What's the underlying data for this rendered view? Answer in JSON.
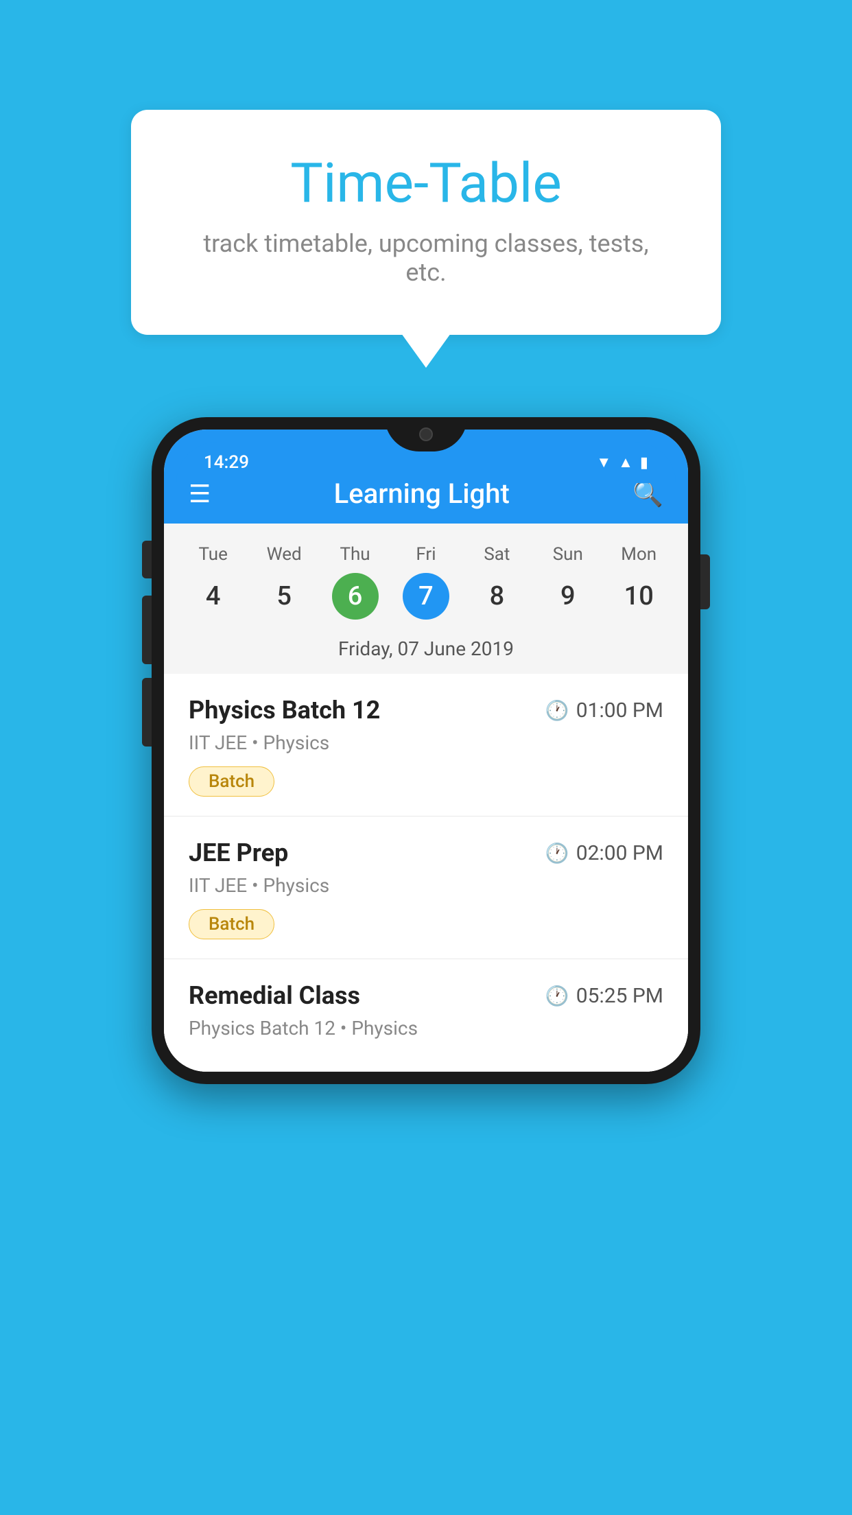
{
  "background_color": "#29B6E8",
  "tooltip": {
    "title": "Time-Table",
    "subtitle": "track timetable, upcoming classes, tests, etc."
  },
  "phone": {
    "status_bar": {
      "time": "14:29"
    },
    "app_bar": {
      "title": "Learning Light",
      "menu_icon": "☰",
      "search_icon": "🔍"
    },
    "calendar": {
      "days": [
        {
          "name": "Tue",
          "num": "4",
          "state": "normal"
        },
        {
          "name": "Wed",
          "num": "5",
          "state": "normal"
        },
        {
          "name": "Thu",
          "num": "6",
          "state": "today"
        },
        {
          "name": "Fri",
          "num": "7",
          "state": "selected"
        },
        {
          "name": "Sat",
          "num": "8",
          "state": "normal"
        },
        {
          "name": "Sun",
          "num": "9",
          "state": "normal"
        },
        {
          "name": "Mon",
          "num": "10",
          "state": "normal"
        }
      ],
      "selected_date_label": "Friday, 07 June 2019"
    },
    "schedule": [
      {
        "title": "Physics Batch 12",
        "time": "01:00 PM",
        "subtitle": "IIT JEE • Physics",
        "badge": "Batch"
      },
      {
        "title": "JEE Prep",
        "time": "02:00 PM",
        "subtitle": "IIT JEE • Physics",
        "badge": "Batch"
      },
      {
        "title": "Remedial Class",
        "time": "05:25 PM",
        "subtitle": "Physics Batch 12 • Physics",
        "badge": null
      }
    ]
  }
}
